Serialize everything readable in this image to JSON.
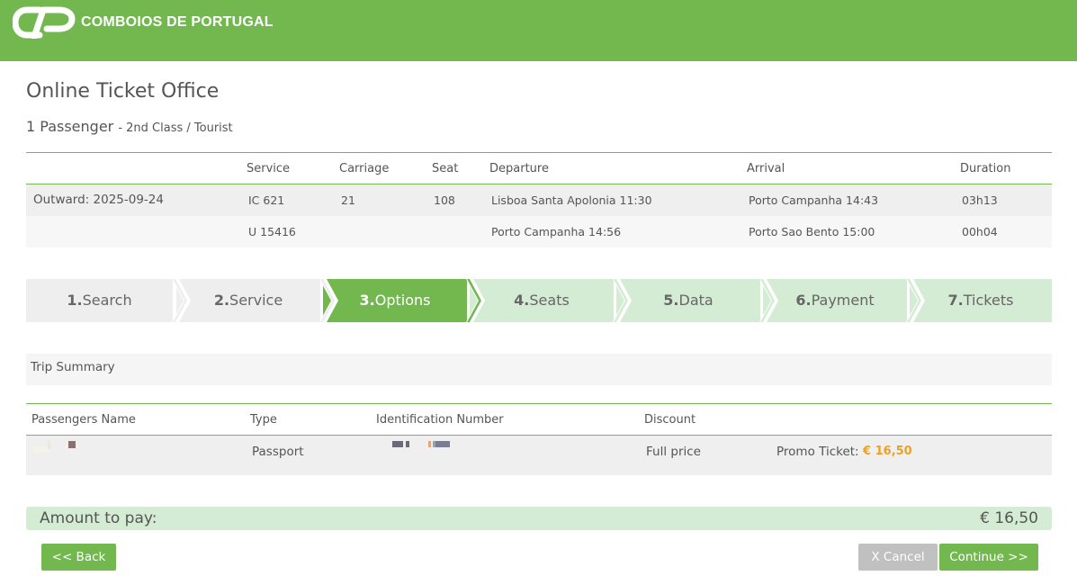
{
  "header": {
    "brand": "COMBOIOS DE PORTUGAL",
    "brand_color": "#72b84f"
  },
  "page": {
    "title": "Online Ticket Office",
    "passengers": "1 Passenger",
    "class_info": "- 2nd Class / Tourist"
  },
  "journey": {
    "headers": {
      "service": "Service",
      "carriage": "Carriage",
      "seat": "Seat",
      "departure": "Departure",
      "arrival": "Arrival",
      "duration": "Duration"
    },
    "rows": [
      {
        "label": "Outward: 2025-09-24",
        "service": "IC 621",
        "carriage": "21",
        "seat": "108",
        "departure": "Lisboa Santa Apolonia 11:30",
        "arrival": "Porto Campanha 14:43",
        "duration": "03h13"
      },
      {
        "label": "",
        "service": "U 15416",
        "carriage": "",
        "seat": "",
        "departure": "Porto Campanha 14:56",
        "arrival": "Porto Sao Bento 15:00",
        "duration": "00h04"
      }
    ]
  },
  "steps": [
    {
      "num": "1.",
      "label": "Search",
      "state": "done"
    },
    {
      "num": "2.",
      "label": "Service",
      "state": "done"
    },
    {
      "num": "3.",
      "label": "Options",
      "state": "active"
    },
    {
      "num": "4.",
      "label": "Seats",
      "state": "todo"
    },
    {
      "num": "5.",
      "label": "Data",
      "state": "todo"
    },
    {
      "num": "6.",
      "label": "Payment",
      "state": "todo"
    },
    {
      "num": "7.",
      "label": "Tickets",
      "state": "todo"
    }
  ],
  "summary": {
    "title": "Trip Summary",
    "headers": {
      "name": "Passengers Name",
      "type": "Type",
      "id": "Identification Number",
      "discount": "Discount"
    },
    "row": {
      "type": "Passport",
      "discount": "Full price",
      "promo_label": "Promo Ticket:",
      "promo_price": "€ 16,50"
    }
  },
  "amount": {
    "label": "Amount to pay:",
    "value": "€ 16,50"
  },
  "buttons": {
    "back": "<< Back",
    "cancel": "X Cancel",
    "continue": "Continue >>"
  }
}
